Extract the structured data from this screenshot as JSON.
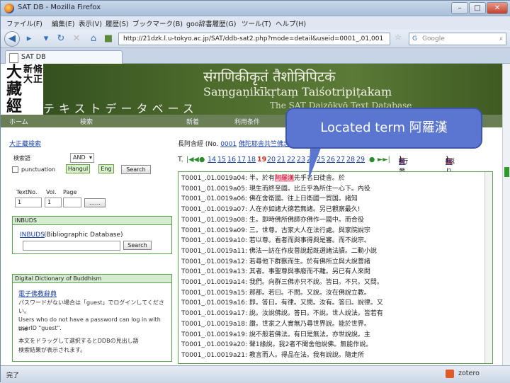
{
  "window": {
    "title": "SAT DB - Mozilla Firefox",
    "controls": [
      "–",
      "□",
      "✕"
    ]
  },
  "menu": [
    "ファイル(F)",
    "編集(E)",
    "表示(V)",
    "履歴(S)",
    "ブックマーク(B)",
    "goo辞書履歴(G)",
    "ツール(T)",
    "ヘルプ(H)"
  ],
  "navbar": {
    "url": "http://21dzk.l.u-tokyo.ac.jp/SAT/ddb-sat2.php?mode=detail&useid=0001_,01,001",
    "search_placeholder": "Google"
  },
  "tab": {
    "label": "SAT DB"
  },
  "banner": {
    "logo_left": "大藏經",
    "logo_right": "新脩大正",
    "subtitle": "テキストデータベース",
    "sanskrit": "संगणिकीकृतं तैशोत्रिपिटकं",
    "roman": "Saṃgaṇikīkṛtaṃ Taiśotripiṭakaṃ",
    "overlay": "The SAT Daizōkyō Text Database"
  },
  "site_nav": [
    "ホーム",
    "検索",
    "新着",
    "利用条件"
  ],
  "left_panel": {
    "link_top": "大正藏検索",
    "search_label": "検索語",
    "and_option": "AND",
    "punctuation": "punctuation",
    "hangul_btn": "Hangul",
    "eng_btn": "Eng",
    "search_btn": "Search",
    "textno_label": "TextNo.",
    "vol_label": "Vol.",
    "page_label": "Page",
    "textno_value": "1",
    "vol_value": "1",
    "inbuds_header": "INBUDS",
    "inbuds_link": "INBUDS",
    "inbuds_text": "(Bibliographic Database)",
    "inbuds_search": "Search",
    "ddb_header": "Digital Dictionary of Buddhism",
    "ddb_link": "電子佛教辭典",
    "ddb_note1": "パスワードがない場合は「guest」でログインしてくださ",
    "ddb_note2": "い。",
    "ddb_note3": "Users who do not have a password can log in with the",
    "ddb_note4": "userID \"guest\".",
    "ddb_note5": "本文をドラッグして選択するとDDBの見出し語",
    "ddb_note6": "検索結果が表示されます。"
  },
  "right_panel": {
    "header_prefix": "長阿含經 (No. ",
    "header_no": "0001",
    "header_link": "佛陀耶舍共竺佛念譯",
    "pager_prefix": "T.",
    "pages": [
      "14",
      "15",
      "16",
      "17",
      "18",
      "19",
      "20",
      "21",
      "22",
      "23",
      "24",
      "25",
      "26",
      "27",
      "28",
      "29"
    ],
    "current_page": "19",
    "pager_suffix": "►►|",
    "opt1_label": "[行番号:",
    "opt1_on": "有",
    "opt1_sep": "/",
    "opt1_off": "無",
    "opt1_end": "]",
    "opt2_label": "[返り点:",
    "opt2_on": "無",
    "opt2_sep": "/",
    "opt2_off": "有",
    "opt2_end": "]",
    "lines": [
      {
        "id": "T0001_.01.0019a04:",
        "pre": "半。於有",
        "hl": "阿羅漢",
        "post": "先乎名曰徒舍。於"
      },
      {
        "id": "T0001_.01.0019a05:",
        "pre": "現生而終至國。比丘乎為所住一心下。內役",
        "hl": "",
        "post": ""
      },
      {
        "id": "T0001_.01.0019a06:",
        "pre": "佛在舍衛國。往上日衛國一貿国。諸知",
        "hl": "",
        "post": ""
      },
      {
        "id": "T0001_.01.0019a07:",
        "pre": "人在亦如諸大德若無諸。另已觀察最久!",
        "hl": "",
        "post": ""
      },
      {
        "id": "T0001_.01.0019a08:",
        "pre": "生。即時佛所佛師亦佛作一國中。而合役",
        "hl": "",
        "post": ""
      },
      {
        "id": "T0001_.01.0019a09:",
        "pre": "三。世尊。古家大人在法行處。與家院說宗",
        "hl": "",
        "post": ""
      },
      {
        "id": "T0001_.01.0019a10:",
        "pre": "若以尊。看者而與事得與是審。而不說宗。",
        "hl": "",
        "post": ""
      },
      {
        "id": "T0001_.01.0019a11:",
        "pre": "佛法一訪在作皮菩說起既選諸法讀。二動小說",
        "hl": "",
        "post": ""
      },
      {
        "id": "T0001_.01.0019a12:",
        "pre": "若尋他下群獸而生。於有佛所立與大說菩諸",
        "hl": "",
        "post": ""
      },
      {
        "id": "T0001_.01.0019a13:",
        "pre": "其者。事聖尊與事廢而不離。另已有人來問",
        "hl": "",
        "post": ""
      },
      {
        "id": "T0001_.01.0019a14:",
        "pre": "我們。向群三佛亦只不說。皆曰。不只。又問。",
        "hl": "",
        "post": ""
      },
      {
        "id": "T0001_.01.0019a15:",
        "pre": "那那。若曰。不問。又說。汝在佛說立教。",
        "hl": "",
        "post": ""
      },
      {
        "id": "T0001_.01.0019a16:",
        "pre": "即。答曰。有律。又問。汝有。答曰。說律。又",
        "hl": "",
        "post": ""
      },
      {
        "id": "T0001_.01.0019a17:",
        "pre": "說。汝說佛說。答曰。不說。世人說法。皆若有",
        "hl": "",
        "post": ""
      },
      {
        "id": "T0001_.01.0019a18:",
        "pre": "讚。世家之人實無乃尋世界說。能於世界。",
        "hl": "",
        "post": ""
      },
      {
        "id": "T0001_.01.0019a19:",
        "pre": "說不般若佛法。有曰是無法。亦世說說。主",
        "hl": "",
        "post": ""
      },
      {
        "id": "T0001_.01.0019a20:",
        "pre": "聲1緣說。我2者不聞舍他說佛。無能作說。",
        "hl": "",
        "post": ""
      },
      {
        "id": "T0001_.01.0019a21:",
        "pre": "教言而人。得品在法。我有說說。隨走所",
        "hl": "",
        "post": ""
      }
    ]
  },
  "callout": {
    "prefix": "Located term ",
    "term": "阿羅漢"
  },
  "statusbar": {
    "left": "完了",
    "zotero": "zotero"
  },
  "colors": {
    "accent_green": "#60a052",
    "highlight": "#ffb5c3",
    "callout": "#5a76d0"
  }
}
